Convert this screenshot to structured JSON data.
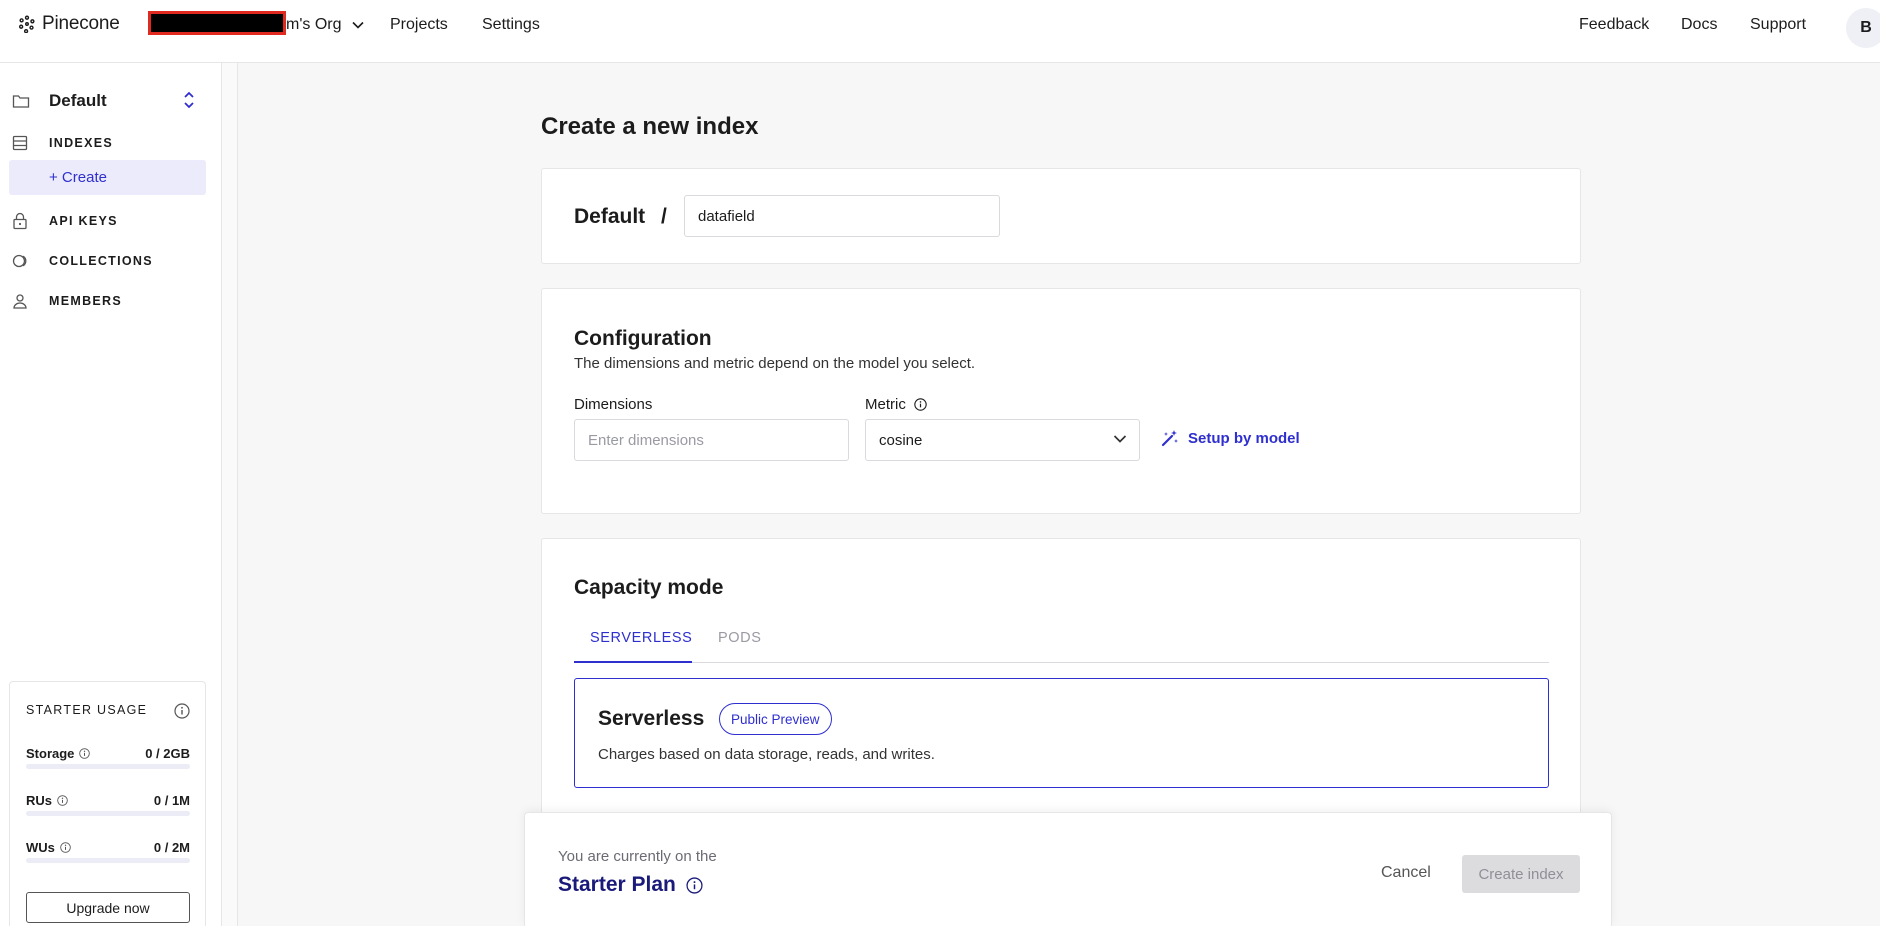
{
  "topbar": {
    "brand": "Pinecone",
    "org_suffix": "m's Org",
    "nav": [
      "Projects",
      "Settings"
    ],
    "right": [
      "Feedback",
      "Docs",
      "Support"
    ],
    "avatar_initial": "B"
  },
  "sidebar": {
    "project_name": "Default",
    "items": [
      {
        "label": "INDEXES",
        "icon": "table-icon"
      },
      {
        "label": "+ Create",
        "icon": ""
      },
      {
        "label": "API KEYS",
        "icon": "lock-icon"
      },
      {
        "label": "COLLECTIONS",
        "icon": "collections-icon"
      },
      {
        "label": "MEMBERS",
        "icon": "person-icon"
      }
    ],
    "usage": {
      "title": "STARTER USAGE",
      "rows": [
        {
          "name": "Storage",
          "value": "0 / 2GB",
          "fraction": 0
        },
        {
          "name": "RUs",
          "value": "0 / 1M",
          "fraction": 0
        },
        {
          "name": "WUs",
          "value": "0 / 2M",
          "fraction": 0
        }
      ],
      "upgrade_label": "Upgrade now"
    }
  },
  "main": {
    "title": "Create a new index",
    "name_card": {
      "project": "Default",
      "separator": "/",
      "index_name": "datafield"
    },
    "config": {
      "title": "Configuration",
      "description": "The dimensions and metric depend on the model you select.",
      "dimensions_label": "Dimensions",
      "dimensions_placeholder": "Enter dimensions",
      "metric_label": "Metric",
      "metric_value": "cosine",
      "setup_label": "Setup by model"
    },
    "capacity": {
      "title": "Capacity mode",
      "tabs": [
        "SERVERLESS",
        "PODS"
      ],
      "active_tab": "SERVERLESS",
      "option_title": "Serverless",
      "badge": "Public Preview",
      "option_desc": "Charges based on data storage, reads, and writes."
    }
  },
  "footer": {
    "note": "You are currently on the",
    "plan": "Starter Plan",
    "cancel": "Cancel",
    "create": "Create index"
  },
  "colors": {
    "accent": "#2f2fd0",
    "create_bg": "#ecebfb",
    "plan_text": "#1a1a7a",
    "redaction": "#e02a1f"
  }
}
